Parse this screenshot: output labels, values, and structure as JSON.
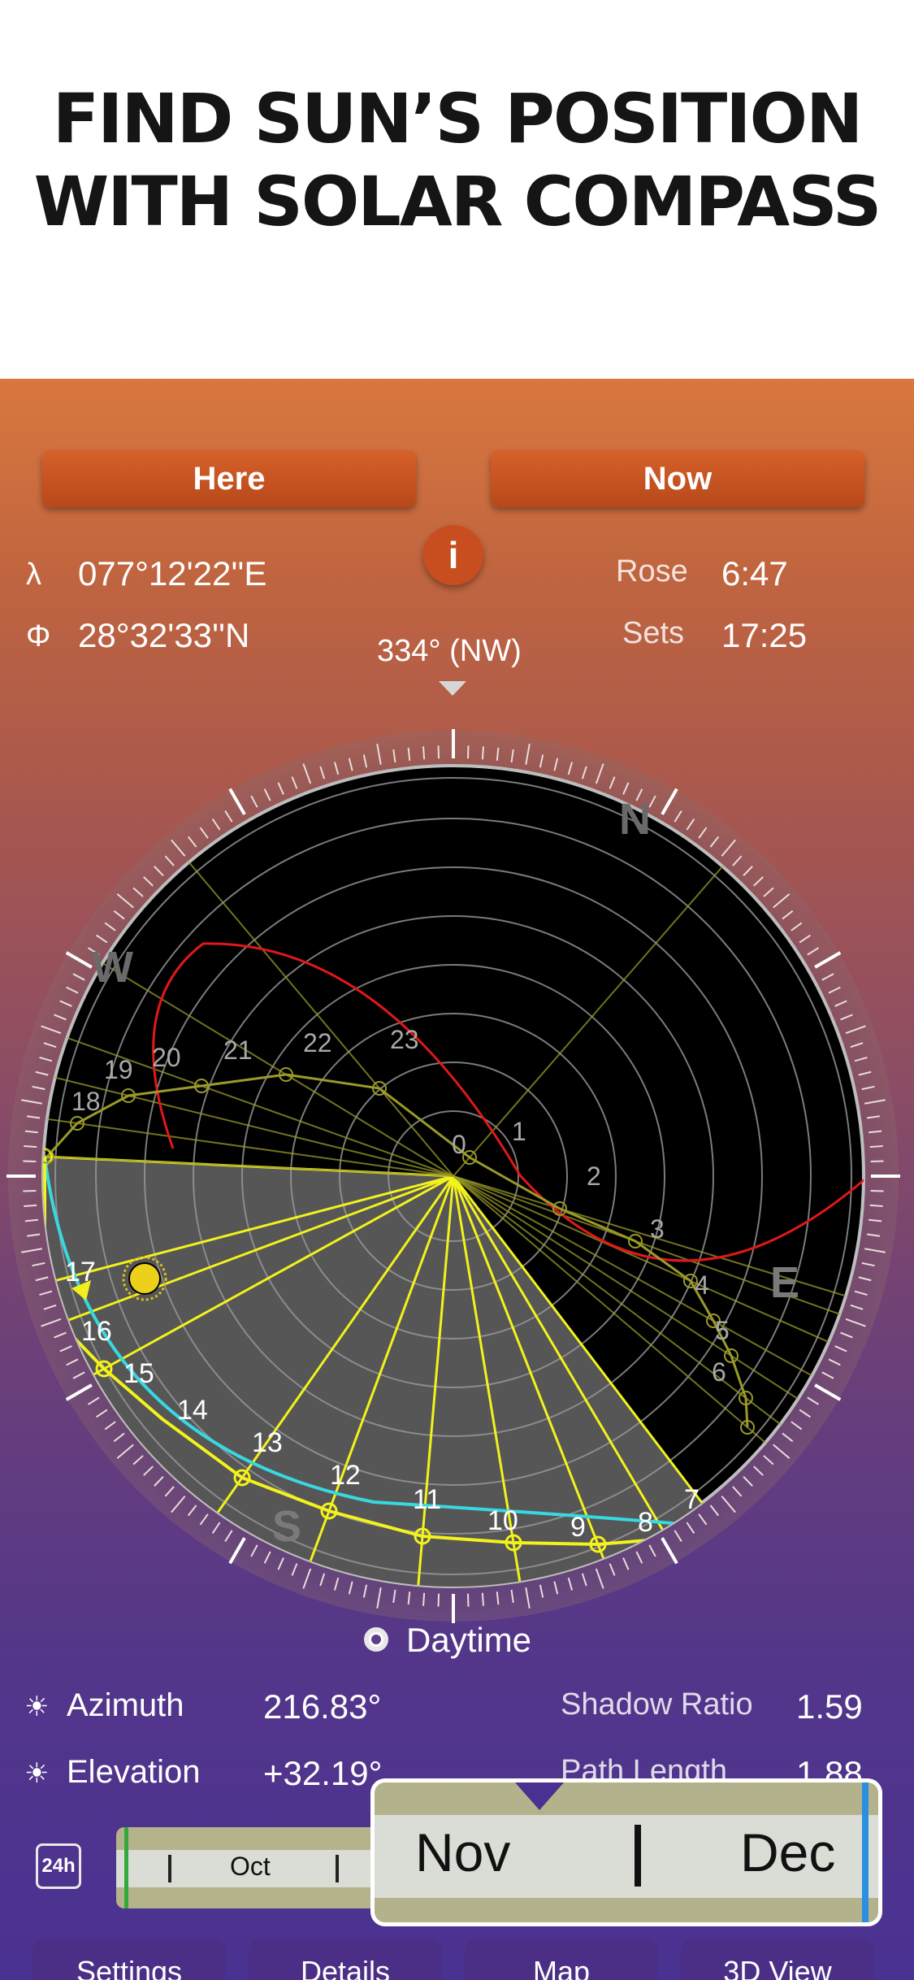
{
  "headline": {
    "line1": "FIND SUN’S POSITION",
    "line2": "WITH SOLAR COMPASS"
  },
  "buttons": {
    "here": "Here",
    "now": "Now",
    "info": "i"
  },
  "location": {
    "longitude_symbol": "λ",
    "longitude": "077°12'22''E",
    "latitude_symbol": "Φ",
    "latitude": "28°32'33''N"
  },
  "sun_times": {
    "rose_label": "Rose",
    "rose_time": "6:47",
    "sets_label": "Sets",
    "sets_time": "17:25"
  },
  "heading": "334° (NW)",
  "compass": {
    "cardinals": [
      "N",
      "E",
      "S",
      "W"
    ],
    "today_hours": [
      "7",
      "8",
      "9",
      "10",
      "11",
      "12",
      "13",
      "14",
      "15",
      "16",
      "17"
    ],
    "summer_hours": [
      "1",
      "2",
      "3",
      "4",
      "5",
      "6",
      "18",
      "19",
      "20",
      "21",
      "22",
      "23",
      "0"
    ],
    "colors": {
      "dial_dark": "#000000",
      "shade": "#565656",
      "today_path": "#f2f21c",
      "summer_path": "#9a9a2a",
      "winter_path": "#38d8e0",
      "horizon_path": "#e01818"
    }
  },
  "daytime_label": "Daytime",
  "stats": {
    "azimuth_label": "Azimuth",
    "azimuth_value": "216.83°",
    "elevation_label": "Elevation",
    "elevation_value": "+32.19°",
    "shadow_label": "Shadow Ratio",
    "shadow_value": "1.59",
    "path_label": "Path Length",
    "path_value": "1.88"
  },
  "timeline": {
    "toggle": "24h",
    "month": "Oct"
  },
  "zoom": {
    "left_month": "Nov",
    "right_month": "Dec"
  },
  "tabs": [
    "Settings",
    "Details",
    "Map",
    "3D View"
  ]
}
